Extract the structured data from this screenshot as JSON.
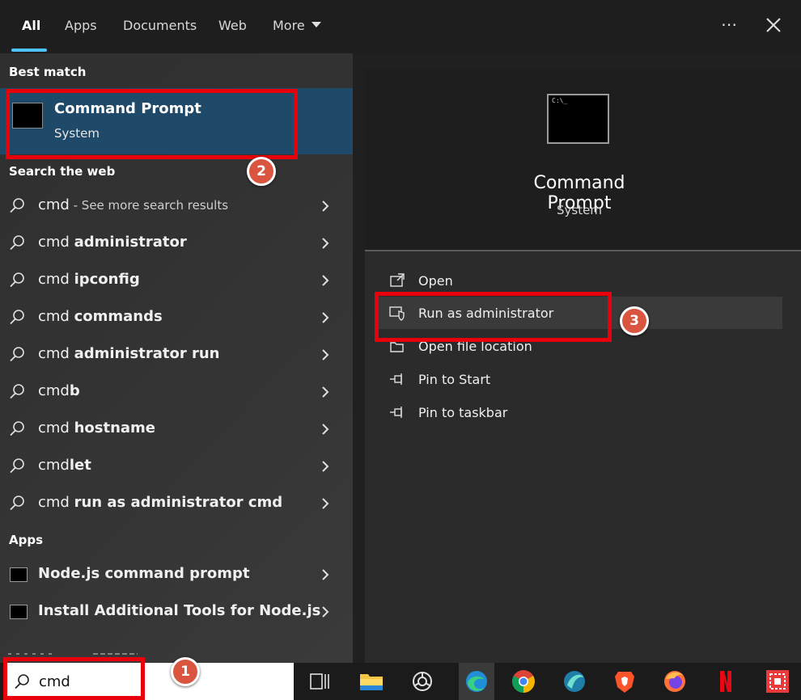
{
  "tabs": [
    {
      "label": "All"
    },
    {
      "label": "Apps"
    },
    {
      "label": "Documents"
    },
    {
      "label": "Web"
    },
    {
      "label": "More"
    }
  ],
  "sections": {
    "best_match": "Best match",
    "search_web": "Search the web",
    "apps": "Apps"
  },
  "best_match": {
    "title": "Command Prompt",
    "subtitle": "System"
  },
  "web_results": [
    {
      "prefix": "cmd",
      "bold": "",
      "hint": " - See more search results"
    },
    {
      "prefix": "cmd ",
      "bold": "administrator",
      "hint": ""
    },
    {
      "prefix": "cmd ",
      "bold": "ipconfig",
      "hint": ""
    },
    {
      "prefix": "cmd ",
      "bold": "commands",
      "hint": ""
    },
    {
      "prefix": "cmd ",
      "bold": "administrator run",
      "hint": ""
    },
    {
      "prefix": "cmd",
      "bold": "b",
      "hint": ""
    },
    {
      "prefix": "cmd ",
      "bold": "hostname",
      "hint": ""
    },
    {
      "prefix": "cmd",
      "bold": "let",
      "hint": ""
    },
    {
      "prefix": "cmd ",
      "bold": "run as administrator cmd",
      "hint": ""
    }
  ],
  "app_results": [
    {
      "label": "Node.js command prompt"
    },
    {
      "label": "Install Additional Tools for Node.js"
    }
  ],
  "preview": {
    "title": "Command Prompt",
    "subtitle": "System",
    "actions": [
      {
        "label": "Open",
        "icon": "open-icon"
      },
      {
        "label": "Run as administrator",
        "icon": "shield-icon"
      },
      {
        "label": "Open file location",
        "icon": "folder-location-icon"
      },
      {
        "label": "Pin to Start",
        "icon": "pin-icon"
      },
      {
        "label": "Pin to taskbar",
        "icon": "pin-icon"
      }
    ]
  },
  "search": {
    "value": "cmd"
  },
  "steps": {
    "one": "1",
    "two": "2",
    "three": "3"
  },
  "taskbar_icons": [
    "task-view-icon",
    "file-explorer-icon",
    "chatgpt-icon",
    "edge-icon",
    "chrome-icon",
    "app-icon",
    "brave-icon",
    "firefox-icon",
    "netflix-icon",
    "store-icon"
  ],
  "colors": {
    "highlight": "#e8000b",
    "badge": "#d9553f",
    "accent": "#4cc2ff",
    "best_match_bg": "#1f4969"
  }
}
